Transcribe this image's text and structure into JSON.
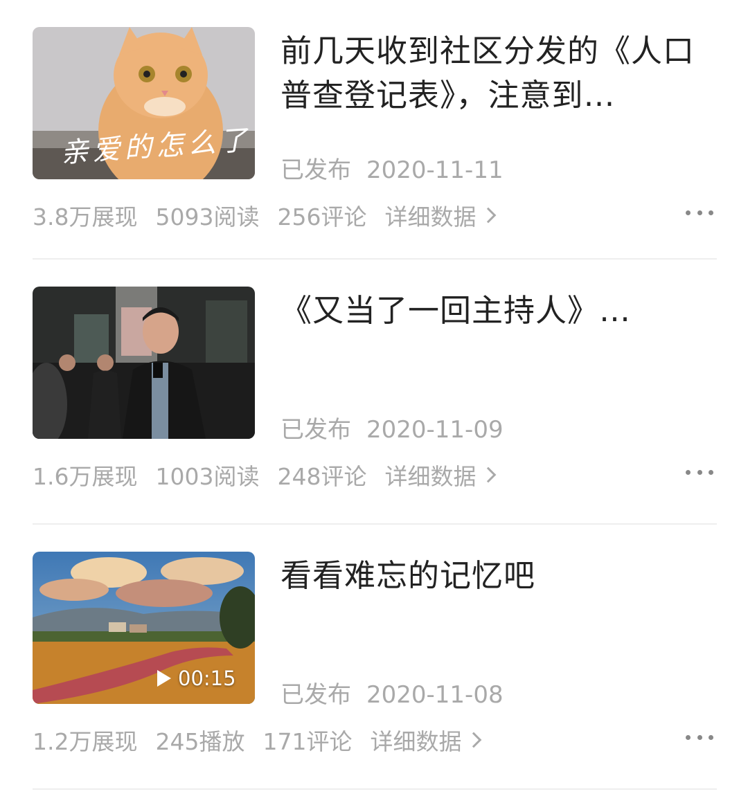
{
  "articles": [
    {
      "title": "前几天收到社区分发的《人口普查登记表》，注意到…",
      "status": "已发布",
      "date": "2020-11-11",
      "impressions": "3.8万展现",
      "reads": "5093阅读",
      "comments": "256评论",
      "detail_label": "详细数据",
      "thumb_caption": "亲爱的怎么了",
      "thumb_icon": "cat-photo"
    },
    {
      "title": "《又当了一回主持人》…",
      "status": "已发布",
      "date": "2020-11-09",
      "impressions": "1.6万展现",
      "reads": "1003阅读",
      "comments": "248评论",
      "detail_label": "详细数据",
      "thumb_icon": "man-selfie-photo"
    },
    {
      "title": "看看难忘的记忆吧",
      "status": "已发布",
      "date": "2020-11-08",
      "impressions": "1.2万展现",
      "plays": "245播放",
      "comments": "171评论",
      "detail_label": "详细数据",
      "video_duration": "00:15",
      "thumb_icon": "landscape-video"
    }
  ]
}
